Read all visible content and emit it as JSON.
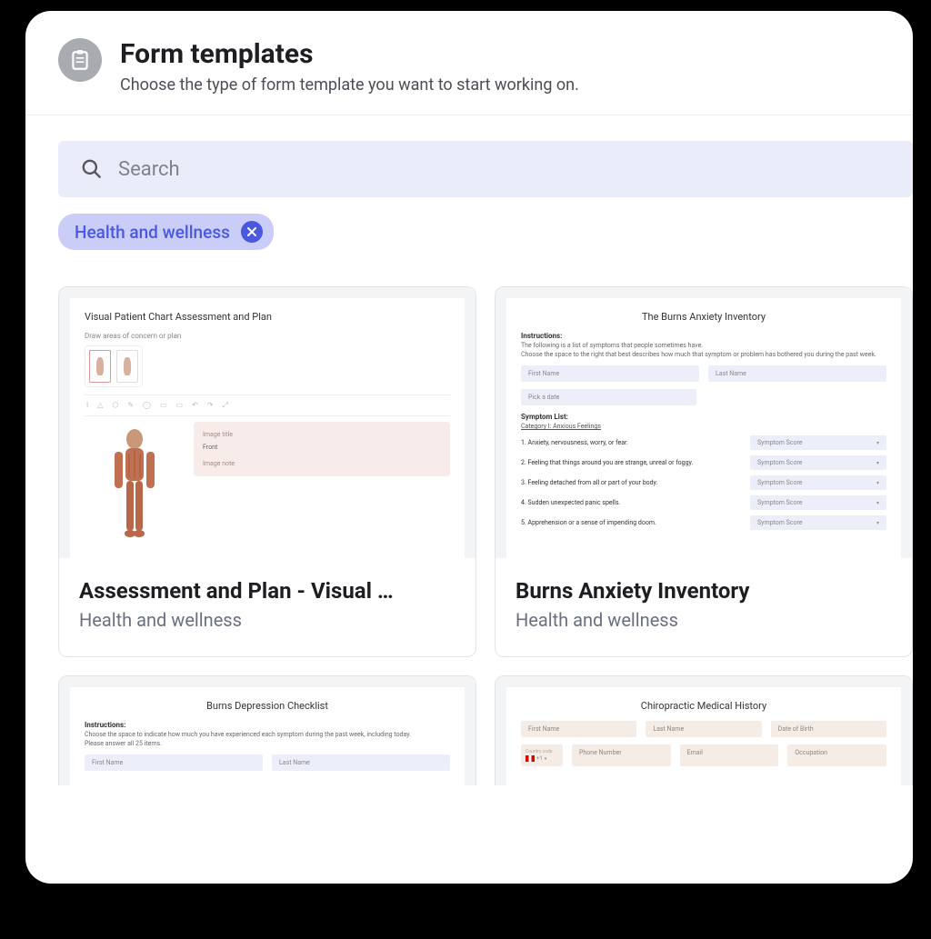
{
  "header": {
    "title": "Form templates",
    "subtitle": "Choose the type of form template you want to start working on."
  },
  "search": {
    "placeholder": "Search"
  },
  "filter_chip": {
    "label": "Health and wellness"
  },
  "cards": [
    {
      "title": "Assessment and Plan - Visual …",
      "category": "Health and wellness",
      "preview": {
        "heading": "Visual Patient Chart Assessment and Plan",
        "subhead": "Draw areas of concern or plan",
        "note_label1": "Image title",
        "note_value1": "Front",
        "note_label2": "Image note"
      }
    },
    {
      "title": "Burns Anxiety Inventory",
      "category": "Health and wellness",
      "preview": {
        "title_center": "The Burns Anxiety Inventory",
        "instr_label": "Instructions:",
        "instr_line1": "The following is a list of symptoms that people sometimes have.",
        "instr_line2": "Choose the space to the right that best describes how much that symptom or problem has bothered you during the past week.",
        "fields": {
          "first": "First Name",
          "last": "Last Name",
          "date": "Pick a date"
        },
        "section": "Symptom List:",
        "category": "Category I: Anxious Feelings",
        "symptoms": [
          "1. Anxiety, nervousness, worry, or fear.",
          "2. Feeling that things around you are strange, unreal or foggy.",
          "3. Feeling detached from all or part of your body.",
          "4. Sudden unexpected panic spells.",
          "5. Apprehension or a sense of impending doom."
        ],
        "select_label": "Symptom Score"
      }
    },
    {
      "title_partial": true,
      "preview": {
        "title_center": "Burns Depression Checklist",
        "instr_label": "Instructions:",
        "instr_line1": "Choose the space to indicate how much you have experienced each symptom during the past week, including today.",
        "instr_line2": "Please answer all 25 items.",
        "fields": {
          "first": "First Name",
          "last": "Last Name"
        }
      }
    },
    {
      "title_partial": true,
      "preview": {
        "title_center": "Chiropractic Medical History",
        "row1": {
          "a": "First Name",
          "b": "Last Name",
          "c": "Date of Birth"
        },
        "row2": {
          "cc": "+1",
          "cclabel": "Country code",
          "a": "Phone Number",
          "b": "Email",
          "c": "Occupation"
        }
      }
    }
  ]
}
